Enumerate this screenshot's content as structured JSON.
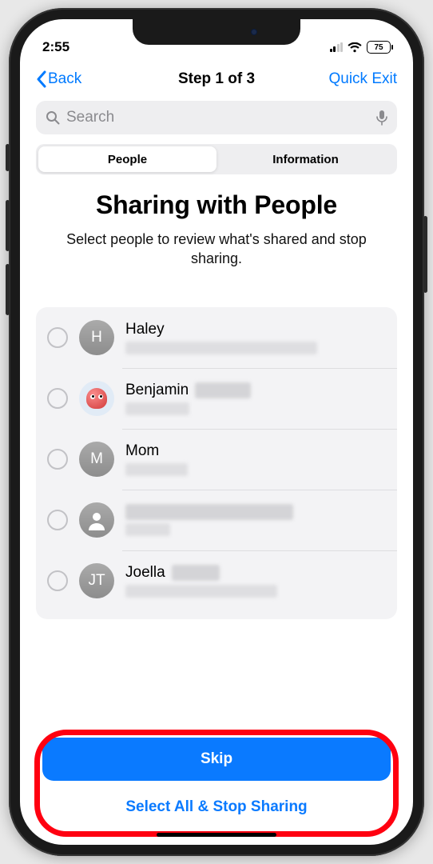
{
  "status": {
    "time": "2:55",
    "battery": "75"
  },
  "nav": {
    "back": "Back",
    "step": "Step 1 of 3",
    "quick_exit": "Quick Exit"
  },
  "search": {
    "placeholder": "Search"
  },
  "tabs": {
    "people": "People",
    "information": "Information",
    "selected": 0
  },
  "header": {
    "title": "Sharing with People",
    "subtitle": "Select people to review what's shared and stop sharing."
  },
  "people": [
    {
      "name": "Haley",
      "initial": "H",
      "avatar": "initial"
    },
    {
      "name": "Benjamin",
      "initial": "",
      "avatar": "octopus"
    },
    {
      "name": "Mom",
      "initial": "M",
      "avatar": "initial"
    },
    {
      "name": "",
      "initial": "",
      "avatar": "person"
    },
    {
      "name": "Joella",
      "initial": "JT",
      "avatar": "initial"
    }
  ],
  "actions": {
    "skip": "Skip",
    "select_all": "Select All & Stop Sharing"
  }
}
